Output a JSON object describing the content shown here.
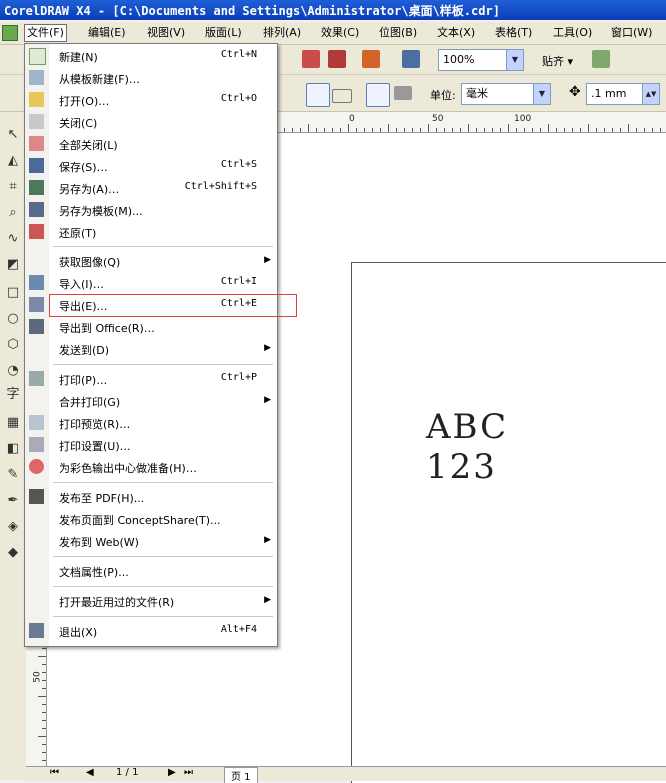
{
  "window": {
    "title": "CorelDRAW X4 - [C:\\Documents and Settings\\Administrator\\桌面\\样板.cdr]"
  },
  "menubar": [
    {
      "label": "文件(F)"
    },
    {
      "label": "编辑(E)"
    },
    {
      "label": "视图(V)"
    },
    {
      "label": "版面(L)"
    },
    {
      "label": "排列(A)"
    },
    {
      "label": "效果(C)"
    },
    {
      "label": "位图(B)"
    },
    {
      "label": "文本(X)"
    },
    {
      "label": "表格(T)"
    },
    {
      "label": "工具(O)"
    },
    {
      "label": "窗口(W)"
    }
  ],
  "toolbar": {
    "zoom_value": "100%",
    "snap_label": "贴齐",
    "unit_label": "单位:",
    "unit_value": "毫米",
    "nudge_value": ".1 mm"
  },
  "ruler": {
    "top_labels": [
      "0",
      "50",
      "100"
    ],
    "left_label": "50"
  },
  "document": {
    "line1": "ABC",
    "line2": "123"
  },
  "navbar": {
    "page_count": "1 / 1",
    "page_tab": "页 1"
  },
  "file_menu": {
    "items": [
      {
        "label": "新建(N)",
        "shortcut": "Ctrl+N"
      },
      {
        "label": "从模板新建(F)…",
        "shortcut": ""
      },
      {
        "label": "打开(O)…",
        "shortcut": "Ctrl+O"
      },
      {
        "label": "关闭(C)",
        "shortcut": ""
      },
      {
        "label": "全部关闭(L)",
        "shortcut": ""
      },
      {
        "label": "保存(S)…",
        "shortcut": "Ctrl+S"
      },
      {
        "label": "另存为(A)…",
        "shortcut": "Ctrl+Shift+S"
      },
      {
        "label": "另存为模板(M)...",
        "shortcut": ""
      },
      {
        "label": "还原(T)",
        "shortcut": ""
      },
      {
        "label": "获取图像(Q)",
        "shortcut": ""
      },
      {
        "label": "导入(I)…",
        "shortcut": "Ctrl+I"
      },
      {
        "label": "导出(E)…",
        "shortcut": "Ctrl+E"
      },
      {
        "label": "导出到 Office(R)…",
        "shortcut": ""
      },
      {
        "label": "发送到(D)",
        "shortcut": ""
      },
      {
        "label": "打印(P)…",
        "shortcut": "Ctrl+P"
      },
      {
        "label": "合并打印(G)",
        "shortcut": ""
      },
      {
        "label": "打印预览(R)…",
        "shortcut": ""
      },
      {
        "label": "打印设置(U)…",
        "shortcut": ""
      },
      {
        "label": "为彩色输出中心做准备(H)…",
        "shortcut": ""
      },
      {
        "label": "发布至 PDF(H)...",
        "shortcut": ""
      },
      {
        "label": "发布页面到 ConceptShare(T)...",
        "shortcut": ""
      },
      {
        "label": "发布到 Web(W)",
        "shortcut": ""
      },
      {
        "label": "文档属性(P)...",
        "shortcut": ""
      },
      {
        "label": "打开最近用过的文件(R)",
        "shortcut": ""
      },
      {
        "label": "退出(X)",
        "shortcut": "Alt+F4"
      }
    ]
  },
  "colors": {
    "titlebar": "#0a3eb6",
    "highlight_border": "#e0413a",
    "menu_bg": "#ffffff"
  }
}
